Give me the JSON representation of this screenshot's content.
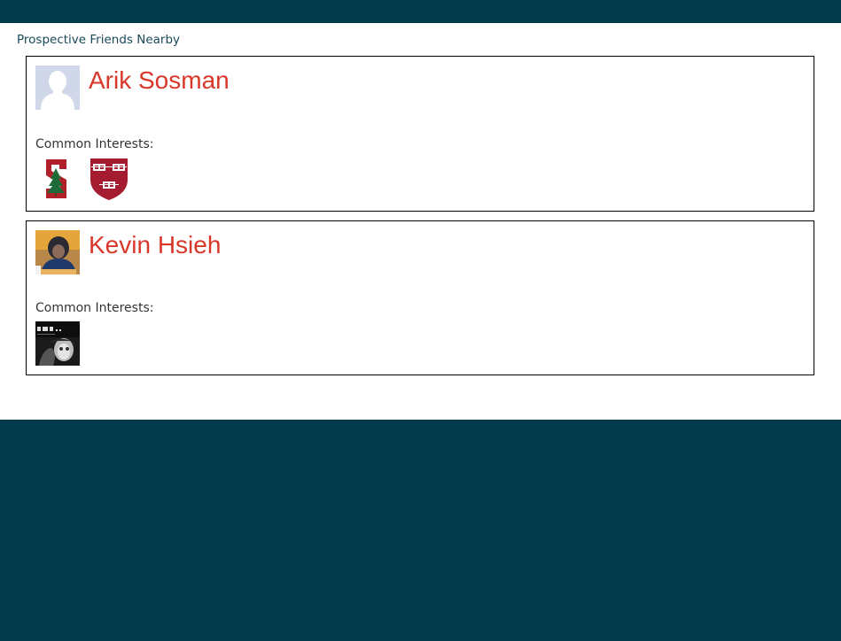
{
  "colors": {
    "page_background": "#013a4a",
    "content_background": "#ffffff",
    "name_link": "#d9372a",
    "section_title": "#1a4a5a"
  },
  "section": {
    "title": "Prospective Friends Nearby"
  },
  "friends": [
    {
      "name": "Arik Sosman",
      "avatar_icon": "default-silhouette-avatar",
      "common_interests_label": "Common Interests:",
      "interests": [
        {
          "icon": "stanford-logo"
        },
        {
          "icon": "harvard-shield-logo"
        }
      ]
    },
    {
      "name": "Kevin Hsieh",
      "avatar_icon": "profile-photo",
      "common_interests_label": "Common Interests:",
      "interests": [
        {
          "icon": "awr-group-photo"
        }
      ]
    }
  ]
}
